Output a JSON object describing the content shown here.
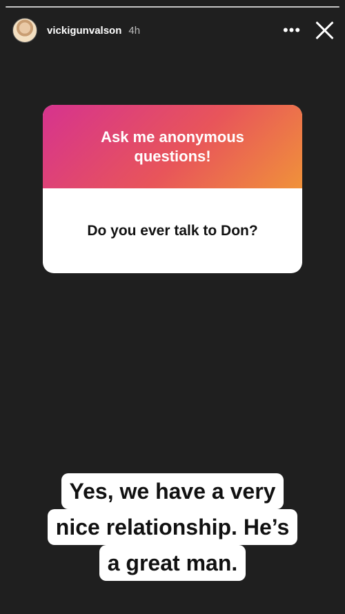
{
  "story": {
    "segment_count": 1,
    "header": {
      "username": "vickigunvalson",
      "time": "4h",
      "more_icon": "more-horizontal-icon",
      "close_icon": "close-icon"
    },
    "question_sticker": {
      "prompt": "Ask me anonymous questions!",
      "question": "Do you ever talk to Don?",
      "gradient_colors": [
        "#d6338e",
        "#e8555a",
        "#f0923a"
      ]
    },
    "answer_lines": [
      "Yes, we have a very",
      "nice relationship.  He’s",
      "a great man."
    ]
  }
}
